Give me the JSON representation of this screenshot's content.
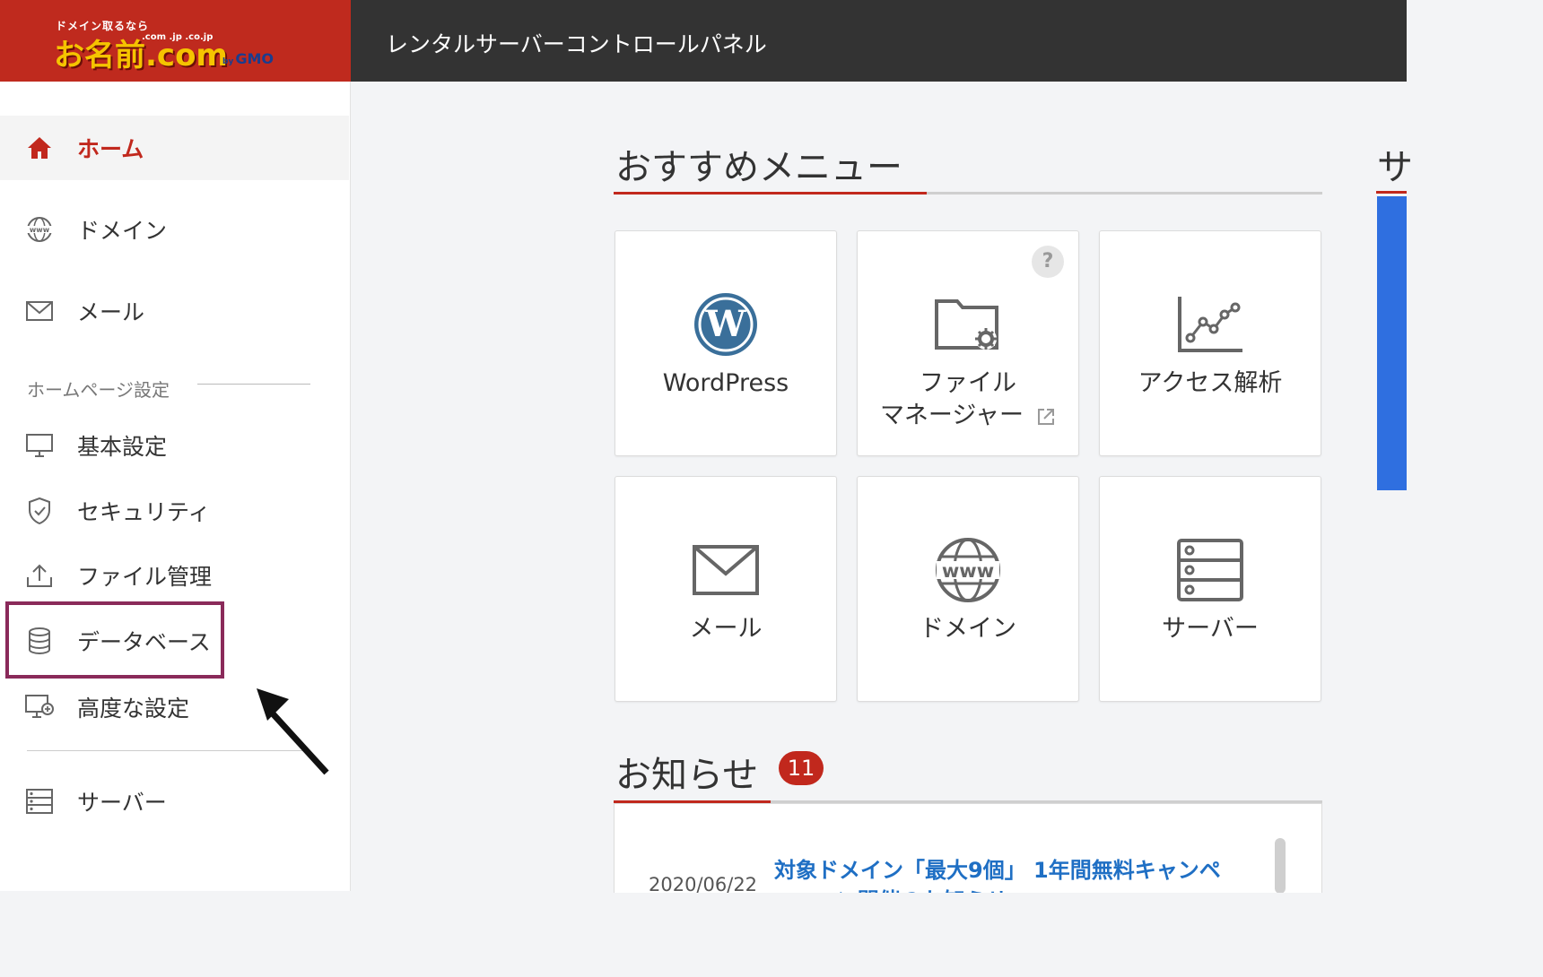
{
  "header": {
    "logo_tagline": "ドメイン取るなら",
    "logo_tlds": ".com .jp .co.jp",
    "logo_main": "お名前.com",
    "logo_by": "by",
    "logo_gmo": "GMO",
    "title": "レンタルサーバーコントロールパネル"
  },
  "sidebar": {
    "items_top": [
      {
        "label": "ホーム",
        "icon": "home-icon",
        "active": true
      },
      {
        "label": "ドメイン",
        "icon": "globe-www-icon"
      },
      {
        "label": "メール",
        "icon": "mail-icon"
      }
    ],
    "section_label": "ホームページ設定",
    "items_site": [
      {
        "label": "基本設定",
        "icon": "monitor-icon"
      },
      {
        "label": "セキュリティ",
        "icon": "shield-check-icon"
      },
      {
        "label": "ファイル管理",
        "icon": "upload-icon"
      },
      {
        "label": "データベース",
        "icon": "database-icon",
        "highlighted": true
      },
      {
        "label": "高度な設定",
        "icon": "monitor-plus-icon"
      }
    ],
    "items_bottom": [
      {
        "label": "サーバー",
        "icon": "server-icon"
      }
    ]
  },
  "main": {
    "recommended": {
      "title": "おすすめメニュー",
      "cards": [
        {
          "label": "WordPress",
          "icon": "wordpress-icon"
        },
        {
          "label": "ファイル\nマネージャー",
          "icon": "folder-gear-icon",
          "help": "?",
          "external_icon": "external-link-icon"
        },
        {
          "label": "アクセス解析",
          "icon": "line-chart-icon"
        },
        {
          "label": "メール",
          "icon": "mail-icon"
        },
        {
          "label": "ドメイン",
          "icon": "globe-www-icon"
        },
        {
          "label": "サーバー",
          "icon": "server-icon"
        }
      ]
    },
    "news": {
      "title": "お知らせ",
      "count": "11",
      "items": [
        {
          "date": "2020/06/22",
          "title": "対象ドメイン「最大9個」 1年間無料キャンペ",
          "title_cont": "ーン開催のお知らせ"
        }
      ]
    },
    "right_clip_title": "サ"
  },
  "colors": {
    "brand_red": "#bf2a1e",
    "header_dark": "#333333",
    "active_red": "#c1281d",
    "link_blue": "#1f6fc4",
    "highlight_border": "#8a2a5a",
    "right_panel_blue": "#2f6fe0"
  }
}
